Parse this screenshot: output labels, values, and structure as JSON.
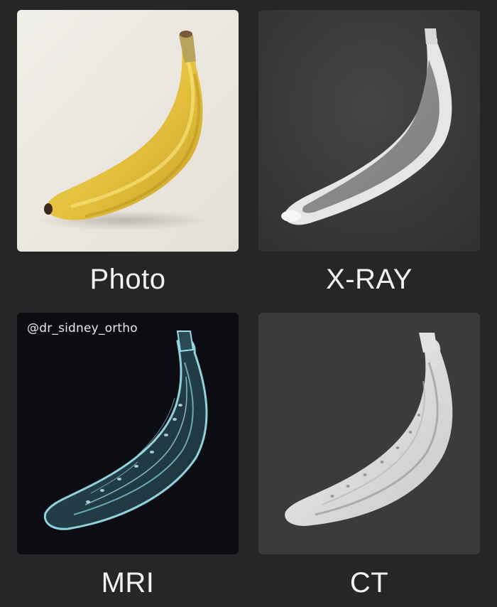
{
  "panels": [
    {
      "id": "photo",
      "caption": "Photo",
      "background": "#ece9e2"
    },
    {
      "id": "xray",
      "caption": "X-RAY",
      "background": "#3a3a3a"
    },
    {
      "id": "mri",
      "caption": "MRI",
      "background": "#0b0d12",
      "watermark": "@dr_sidney_ortho"
    },
    {
      "id": "ct",
      "caption": "CT",
      "background": "#3b3b3b"
    }
  ],
  "colors": {
    "page_background": "#262626",
    "banana_yellow": "#e8c642",
    "mri_cyan": "#8fd3e0",
    "ct_white": "#e6e6e6"
  }
}
